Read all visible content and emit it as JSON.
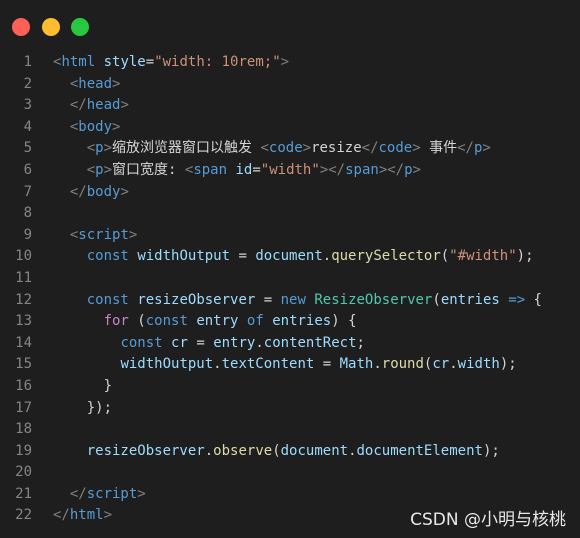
{
  "window": {
    "controls": [
      "close",
      "minimize",
      "maximize"
    ],
    "colors": {
      "background": "#1e1e1e",
      "close": "#fe5f57",
      "minimize": "#febc2e",
      "maximize": "#28c840"
    }
  },
  "code": {
    "lines": [
      {
        "n": "1",
        "tokens": [
          [
            "t-br",
            "<"
          ],
          [
            "t-tag",
            "html"
          ],
          [
            "t-text",
            " "
          ],
          [
            "t-attr",
            "style"
          ],
          [
            "t-text",
            "="
          ],
          [
            "t-str",
            "\"width: 10rem;\""
          ],
          [
            "t-br",
            ">"
          ]
        ]
      },
      {
        "n": "2",
        "tokens": [
          [
            "t-text",
            "  "
          ],
          [
            "t-br",
            "<"
          ],
          [
            "t-tag",
            "head"
          ],
          [
            "t-br",
            ">"
          ]
        ]
      },
      {
        "n": "3",
        "tokens": [
          [
            "t-text",
            "  "
          ],
          [
            "t-br",
            "</"
          ],
          [
            "t-tag",
            "head"
          ],
          [
            "t-br",
            ">"
          ]
        ]
      },
      {
        "n": "4",
        "tokens": [
          [
            "t-text",
            "  "
          ],
          [
            "t-br",
            "<"
          ],
          [
            "t-tag",
            "body"
          ],
          [
            "t-br",
            ">"
          ]
        ]
      },
      {
        "n": "5",
        "tokens": [
          [
            "t-text",
            "    "
          ],
          [
            "t-br",
            "<"
          ],
          [
            "t-tag",
            "p"
          ],
          [
            "t-br",
            ">"
          ],
          [
            "t-text",
            "缩放浏览器窗口以触发 "
          ],
          [
            "t-br",
            "<"
          ],
          [
            "t-tag",
            "code"
          ],
          [
            "t-br",
            ">"
          ],
          [
            "t-text",
            "resize"
          ],
          [
            "t-br",
            "</"
          ],
          [
            "t-tag",
            "code"
          ],
          [
            "t-br",
            ">"
          ],
          [
            "t-text",
            " 事件"
          ],
          [
            "t-br",
            "</"
          ],
          [
            "t-tag",
            "p"
          ],
          [
            "t-br",
            ">"
          ]
        ]
      },
      {
        "n": "6",
        "tokens": [
          [
            "t-text",
            "    "
          ],
          [
            "t-br",
            "<"
          ],
          [
            "t-tag",
            "p"
          ],
          [
            "t-br",
            ">"
          ],
          [
            "t-text",
            "窗口宽度: "
          ],
          [
            "t-br",
            "<"
          ],
          [
            "t-tag",
            "span"
          ],
          [
            "t-text",
            " "
          ],
          [
            "t-attr",
            "id"
          ],
          [
            "t-text",
            "="
          ],
          [
            "t-str",
            "\"width\""
          ],
          [
            "t-br",
            "></"
          ],
          [
            "t-tag",
            "span"
          ],
          [
            "t-br",
            "></"
          ],
          [
            "t-tag",
            "p"
          ],
          [
            "t-br",
            ">"
          ]
        ]
      },
      {
        "n": "7",
        "tokens": [
          [
            "t-text",
            "  "
          ],
          [
            "t-br",
            "</"
          ],
          [
            "t-tag",
            "body"
          ],
          [
            "t-br",
            ">"
          ]
        ]
      },
      {
        "n": "8",
        "tokens": []
      },
      {
        "n": "9",
        "tokens": [
          [
            "t-text",
            "  "
          ],
          [
            "t-br",
            "<"
          ],
          [
            "t-tag",
            "script"
          ],
          [
            "t-br",
            ">"
          ]
        ]
      },
      {
        "n": "10",
        "tokens": [
          [
            "t-text",
            "    "
          ],
          [
            "t-kw",
            "const"
          ],
          [
            "t-text",
            " "
          ],
          [
            "t-var",
            "widthOutput"
          ],
          [
            "t-op",
            " = "
          ],
          [
            "t-var",
            "document"
          ],
          [
            "t-op",
            "."
          ],
          [
            "t-fn",
            "querySelector"
          ],
          [
            "t-op",
            "("
          ],
          [
            "t-str",
            "\"#width\""
          ],
          [
            "t-op",
            ");"
          ]
        ]
      },
      {
        "n": "11",
        "tokens": []
      },
      {
        "n": "12",
        "tokens": [
          [
            "t-text",
            "    "
          ],
          [
            "t-kw",
            "const"
          ],
          [
            "t-text",
            " "
          ],
          [
            "t-var",
            "resizeObserver"
          ],
          [
            "t-op",
            " = "
          ],
          [
            "t-kw",
            "new"
          ],
          [
            "t-text",
            " "
          ],
          [
            "t-cls",
            "ResizeObserver"
          ],
          [
            "t-op",
            "("
          ],
          [
            "t-var",
            "entries"
          ],
          [
            "t-text",
            " "
          ],
          [
            "t-kw",
            "=>"
          ],
          [
            "t-op",
            " {"
          ]
        ]
      },
      {
        "n": "13",
        "tokens": [
          [
            "t-text",
            "      "
          ],
          [
            "t-ctl",
            "for"
          ],
          [
            "t-op",
            " ("
          ],
          [
            "t-kw",
            "const"
          ],
          [
            "t-text",
            " "
          ],
          [
            "t-var",
            "entry"
          ],
          [
            "t-text",
            " "
          ],
          [
            "t-kw",
            "of"
          ],
          [
            "t-text",
            " "
          ],
          [
            "t-var",
            "entries"
          ],
          [
            "t-op",
            ") {"
          ]
        ]
      },
      {
        "n": "14",
        "tokens": [
          [
            "t-text",
            "        "
          ],
          [
            "t-kw",
            "const"
          ],
          [
            "t-text",
            " "
          ],
          [
            "t-var",
            "cr"
          ],
          [
            "t-op",
            " = "
          ],
          [
            "t-var",
            "entry"
          ],
          [
            "t-op",
            "."
          ],
          [
            "t-var",
            "contentRect"
          ],
          [
            "t-op",
            ";"
          ]
        ]
      },
      {
        "n": "15",
        "tokens": [
          [
            "t-text",
            "        "
          ],
          [
            "t-var",
            "widthOutput"
          ],
          [
            "t-op",
            "."
          ],
          [
            "t-var",
            "textContent"
          ],
          [
            "t-op",
            " = "
          ],
          [
            "t-var",
            "Math"
          ],
          [
            "t-op",
            "."
          ],
          [
            "t-fn",
            "round"
          ],
          [
            "t-op",
            "("
          ],
          [
            "t-var",
            "cr"
          ],
          [
            "t-op",
            "."
          ],
          [
            "t-var",
            "width"
          ],
          [
            "t-op",
            ");"
          ]
        ]
      },
      {
        "n": "16",
        "tokens": [
          [
            "t-text",
            "      "
          ],
          [
            "t-op",
            "}"
          ]
        ]
      },
      {
        "n": "17",
        "tokens": [
          [
            "t-text",
            "    "
          ],
          [
            "t-op",
            "});"
          ]
        ]
      },
      {
        "n": "18",
        "tokens": []
      },
      {
        "n": "19",
        "tokens": [
          [
            "t-text",
            "    "
          ],
          [
            "t-var",
            "resizeObserver"
          ],
          [
            "t-op",
            "."
          ],
          [
            "t-fn",
            "observe"
          ],
          [
            "t-op",
            "("
          ],
          [
            "t-var",
            "document"
          ],
          [
            "t-op",
            "."
          ],
          [
            "t-var",
            "documentElement"
          ],
          [
            "t-op",
            ");"
          ]
        ]
      },
      {
        "n": "20",
        "tokens": []
      },
      {
        "n": "21",
        "tokens": [
          [
            "t-text",
            "  "
          ],
          [
            "t-br",
            "</"
          ],
          [
            "t-tag",
            "script"
          ],
          [
            "t-br",
            ">"
          ]
        ]
      },
      {
        "n": "22",
        "tokens": [
          [
            "t-br",
            "</"
          ],
          [
            "t-tag",
            "html"
          ],
          [
            "t-br",
            ">"
          ]
        ]
      }
    ]
  },
  "watermark": "CSDN @小明与核桃"
}
